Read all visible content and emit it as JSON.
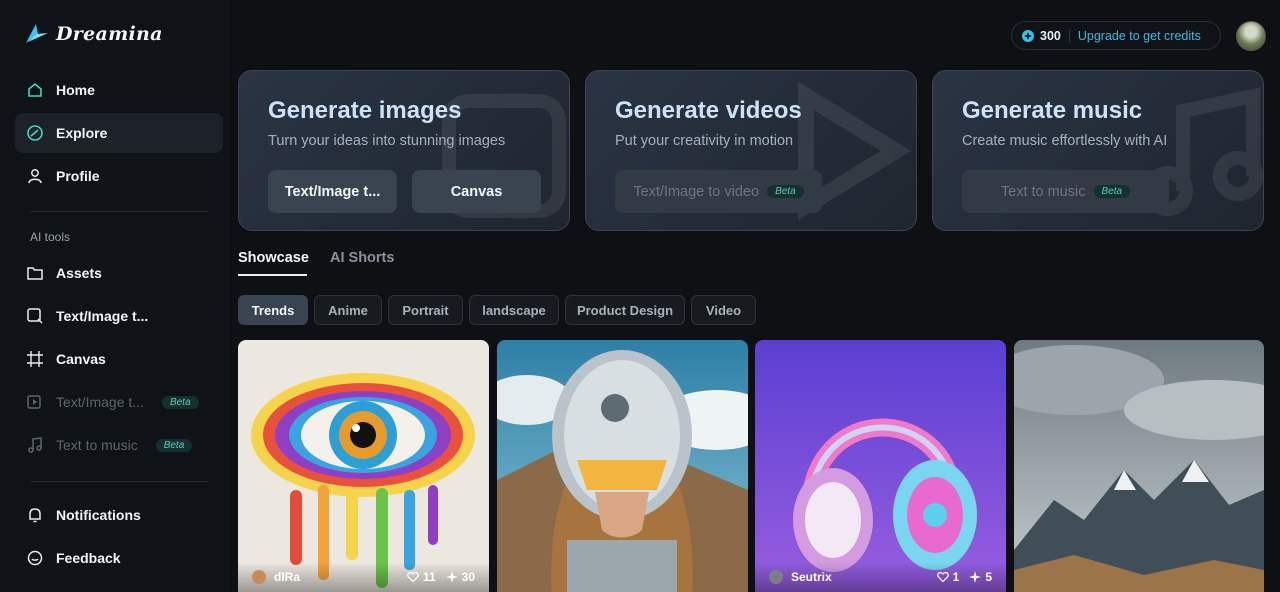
{
  "brand": {
    "name": "Dreamina"
  },
  "sidebar": {
    "items": [
      {
        "label": "Home",
        "icon": "home-icon"
      },
      {
        "label": "Explore",
        "icon": "explore-icon"
      },
      {
        "label": "Profile",
        "icon": "profile-icon"
      }
    ],
    "section_label": "AI tools",
    "tools": [
      {
        "label": "Assets",
        "icon": "folder-icon"
      },
      {
        "label": "Text/Image t...",
        "icon": "image-gen-icon"
      },
      {
        "label": "Canvas",
        "icon": "canvas-icon"
      },
      {
        "label": "Text/Image t...",
        "icon": "video-gen-icon",
        "badge": "Beta"
      },
      {
        "label": "Text to music",
        "icon": "music-icon",
        "badge": "Beta"
      }
    ],
    "bottom": [
      {
        "label": "Notifications",
        "icon": "bell-icon"
      },
      {
        "label": "Feedback",
        "icon": "feedback-icon"
      }
    ]
  },
  "header": {
    "credits_count": "300",
    "upgrade_label": "Upgrade to get credits"
  },
  "cards": [
    {
      "title": "Generate images",
      "subtitle": "Turn your ideas into stunning images",
      "buttons": [
        {
          "label": "Text/Image t..."
        },
        {
          "label": "Canvas"
        }
      ]
    },
    {
      "title": "Generate videos",
      "subtitle": "Put your creativity in motion",
      "buttons": [
        {
          "label": "Text/Image to video",
          "badge": "Beta"
        }
      ]
    },
    {
      "title": "Generate music",
      "subtitle": "Create music effortlessly with AI",
      "buttons": [
        {
          "label": "Text to music",
          "badge": "Beta"
        }
      ]
    }
  ],
  "tabs": [
    {
      "label": "Showcase"
    },
    {
      "label": "AI Shorts"
    }
  ],
  "chips": [
    {
      "label": "Trends"
    },
    {
      "label": "Anime"
    },
    {
      "label": "Portrait"
    },
    {
      "label": "landscape"
    },
    {
      "label": "Product Design"
    },
    {
      "label": "Video"
    }
  ],
  "gallery": [
    {
      "author": "dIRa",
      "likes": "11",
      "remixes": "30",
      "subject": "rainbow-eye"
    },
    {
      "subject": "astronaut-girl"
    },
    {
      "author": "Seutrix",
      "likes": "1",
      "remixes": "5",
      "subject": "headphones"
    },
    {
      "subject": "mountains"
    }
  ],
  "colors": {
    "accent": "#3fb9e0",
    "beta": "#5bc9c0",
    "background": "#0e1013"
  }
}
